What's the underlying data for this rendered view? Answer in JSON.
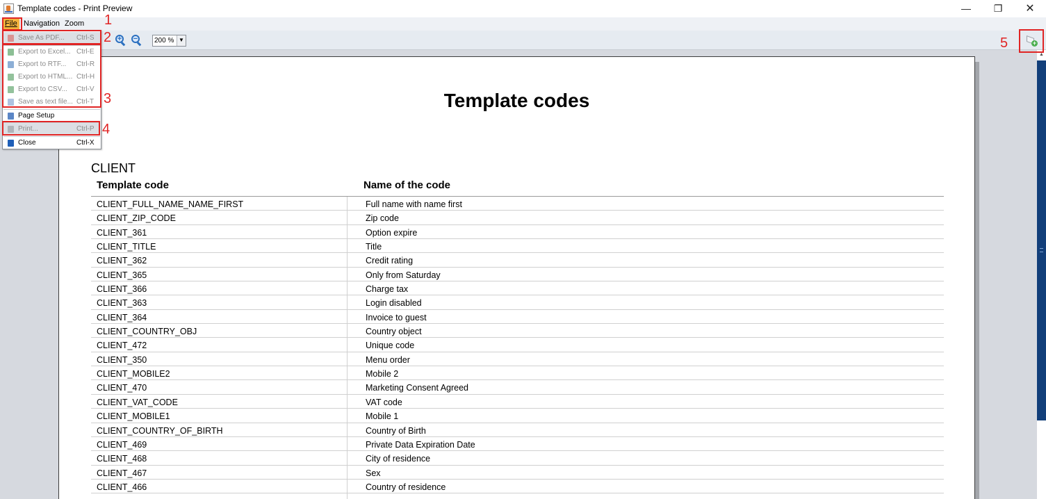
{
  "window": {
    "title": "Template codes - Print Preview",
    "minimize_glyph": "—",
    "maximize_glyph": "❐",
    "close_glyph": "✕"
  },
  "menubar": {
    "file": "File",
    "navigation": "Navigation",
    "zoom": "Zoom"
  },
  "toolbar": {
    "zoom_value": "200 %",
    "zoom_arrow": "▼",
    "icons": [
      "zoom-in-icon",
      "zoom-out-icon",
      "settings-icon"
    ]
  },
  "file_menu": {
    "items": [
      {
        "label": "Save As PDF...",
        "shortcut": "Ctrl-S",
        "enabled": false,
        "icon": "pdf-icon",
        "icon_color": "#d9534f"
      },
      {
        "label": "Export to Excel...",
        "shortcut": "Ctrl-E",
        "enabled": false,
        "icon": "excel-icon",
        "icon_color": "#2e8b3e"
      },
      {
        "label": "Export to RTF...",
        "shortcut": "Ctrl-R",
        "enabled": false,
        "icon": "rtf-icon",
        "icon_color": "#2f6db5"
      },
      {
        "label": "Export to HTML...",
        "shortcut": "Ctrl-H",
        "enabled": false,
        "icon": "html-icon",
        "icon_color": "#3a8f4a"
      },
      {
        "label": "Export to CSV...",
        "shortcut": "Ctrl-V",
        "enabled": false,
        "icon": "csv-icon",
        "icon_color": "#3a8f4a"
      },
      {
        "label": "Save as text file...",
        "shortcut": "Ctrl-T",
        "enabled": false,
        "icon": "text-file-icon",
        "icon_color": "#6b8fc9"
      },
      {
        "label": "Page Setup",
        "shortcut": "",
        "enabled": true,
        "icon": "page-setup-icon",
        "icon_color": "#5b86c6"
      },
      {
        "label": "Print...",
        "shortcut": "Ctrl-P",
        "enabled": false,
        "icon": "printer-icon",
        "icon_color": "#8a8f96"
      },
      {
        "label": "Close",
        "shortcut": "Ctrl-X",
        "enabled": true,
        "icon": "close-arrow-icon",
        "icon_color": "#1f5fb8"
      }
    ]
  },
  "annotations": [
    "1",
    "2",
    "3",
    "4",
    "5"
  ],
  "colors": {
    "highlight": "#e02424",
    "file_menu_active": "#f3b33d",
    "scroll_thumb": "#123f7a"
  },
  "report": {
    "title": "Template codes",
    "section": "CLIENT",
    "columns": [
      "Template code",
      "Name of the code"
    ],
    "rows": [
      [
        "CLIENT_FULL_NAME_NAME_FIRST",
        "Full name with name first"
      ],
      [
        "CLIENT_ZIP_CODE",
        "Zip code"
      ],
      [
        "CLIENT_361",
        "Option expire"
      ],
      [
        "CLIENT_TITLE",
        "Title"
      ],
      [
        "CLIENT_362",
        "Credit rating"
      ],
      [
        "CLIENT_365",
        "Only from Saturday"
      ],
      [
        "CLIENT_366",
        "Charge tax"
      ],
      [
        "CLIENT_363",
        "Login disabled"
      ],
      [
        "CLIENT_364",
        "Invoice to guest"
      ],
      [
        "CLIENT_COUNTRY_OBJ",
        "Country object"
      ],
      [
        "CLIENT_472",
        "Unique code"
      ],
      [
        "CLIENT_350",
        "Menu order"
      ],
      [
        "CLIENT_MOBILE2",
        "Mobile 2"
      ],
      [
        "CLIENT_470",
        "Marketing Consent Agreed"
      ],
      [
        "CLIENT_VAT_CODE",
        "VAT code"
      ],
      [
        "CLIENT_MOBILE1",
        "Mobile 1"
      ],
      [
        "CLIENT_COUNTRY_OF_BIRTH",
        "Country of Birth"
      ],
      [
        "CLIENT_469",
        "Private Data Expiration Date"
      ],
      [
        "CLIENT_468",
        "City of residence"
      ],
      [
        "CLIENT_467",
        "Sex"
      ],
      [
        "CLIENT_466",
        "Country of residence"
      ]
    ]
  }
}
